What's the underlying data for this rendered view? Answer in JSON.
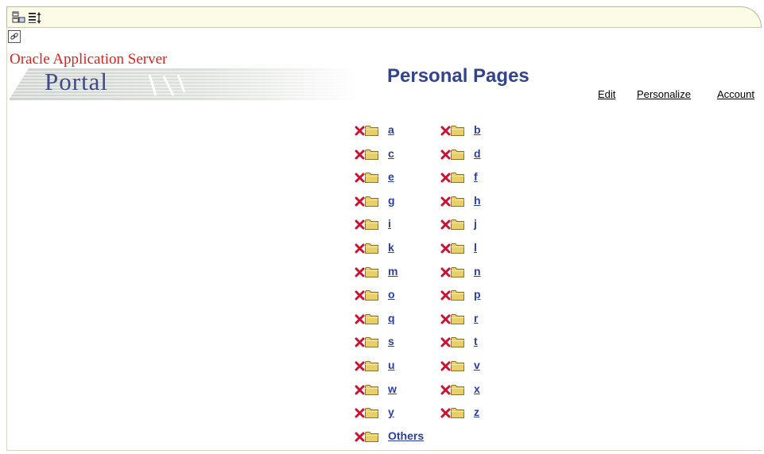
{
  "toolbar": {
    "icons": [
      "customize-page-icon",
      "reorder-icon"
    ]
  },
  "branding": {
    "vendor": "Oracle Application Server",
    "product": "Portal"
  },
  "header": {
    "title": "Personal Pages",
    "links": {
      "edit": "Edit",
      "personalize": "Personalize",
      "account": "Account"
    }
  },
  "pages": {
    "left": [
      "a",
      "c",
      "e",
      "g",
      "i",
      "k",
      "m",
      "o",
      "q",
      "s",
      "u",
      "w",
      "y"
    ],
    "right": [
      "b",
      "d",
      "f",
      "h",
      "j",
      "l",
      "n",
      "p",
      "r",
      "t",
      "v",
      "x",
      "z"
    ],
    "others": "Others"
  },
  "colors": {
    "link": "#2b3fa0",
    "title": "#33448f",
    "vendor": "#e2211c",
    "delete": "#cc1133",
    "folder": "#e8cf6a"
  }
}
